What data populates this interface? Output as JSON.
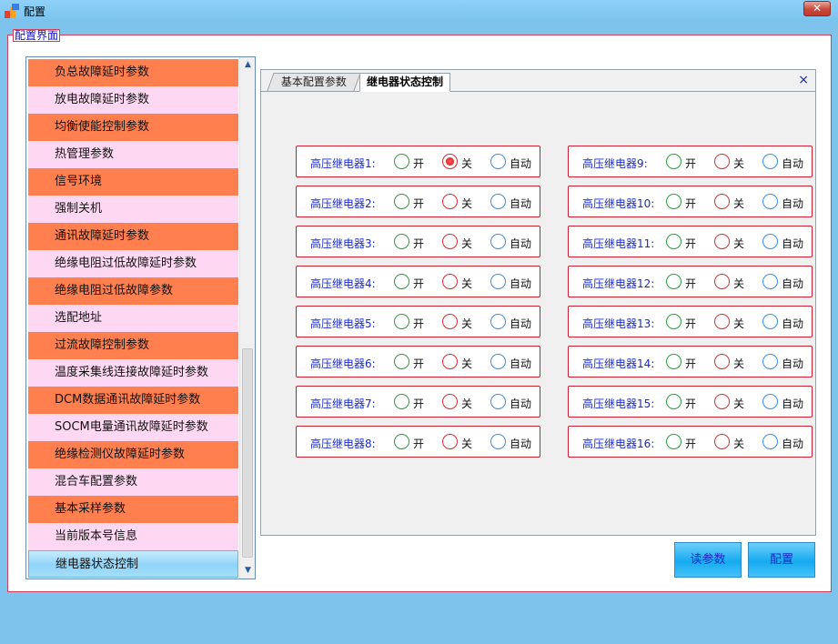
{
  "window": {
    "title": "配置",
    "close_glyph": "✕"
  },
  "group": {
    "label": "配置界面"
  },
  "sidebar": {
    "items": [
      {
        "label": "负总故障延时参数",
        "color": "orange"
      },
      {
        "label": "放电故障延时参数",
        "color": "pink"
      },
      {
        "label": "均衡使能控制参数",
        "color": "orange"
      },
      {
        "label": "热管理参数",
        "color": "pink"
      },
      {
        "label": "信号环境",
        "color": "orange"
      },
      {
        "label": "强制关机",
        "color": "pink"
      },
      {
        "label": "通讯故障延时参数",
        "color": "orange"
      },
      {
        "label": "绝缘电阻过低故障延时参数",
        "color": "pink"
      },
      {
        "label": "绝缘电阻过低故障参数",
        "color": "orange"
      },
      {
        "label": "选配地址",
        "color": "pink"
      },
      {
        "label": "过流故障控制参数",
        "color": "orange"
      },
      {
        "label": "温度采集线连接故障延时参数",
        "color": "pink"
      },
      {
        "label": "DCM数据通讯故障延时参数",
        "color": "orange"
      },
      {
        "label": "SOCM电量通讯故障延时参数",
        "color": "pink"
      },
      {
        "label": "绝缘检测仪故障延时参数",
        "color": "orange"
      },
      {
        "label": "混合车配置参数",
        "color": "pink"
      },
      {
        "label": "基本采样参数",
        "color": "orange"
      },
      {
        "label": "当前版本号信息",
        "color": "pink"
      },
      {
        "label": "继电器状态控制",
        "color": "selected"
      }
    ],
    "scroll_up_glyph": "▲",
    "scroll_down_glyph": "▼"
  },
  "tabs": {
    "items": [
      {
        "label": "基本配置参数",
        "active": false
      },
      {
        "label": "继电器状态控制",
        "active": true
      }
    ],
    "close_glyph": "×"
  },
  "relay_options": {
    "on": "开",
    "off": "关",
    "auto": "自动"
  },
  "relays": [
    {
      "label": "高压继电器1:",
      "selected": "off"
    },
    {
      "label": "高压继电器2:",
      "selected": "none"
    },
    {
      "label": "高压继电器3:",
      "selected": "none"
    },
    {
      "label": "高压继电器4:",
      "selected": "none"
    },
    {
      "label": "高压继电器5:",
      "selected": "none"
    },
    {
      "label": "高压继电器6:",
      "selected": "none"
    },
    {
      "label": "高压继电器7:",
      "selected": "none"
    },
    {
      "label": "高压继电器8:",
      "selected": "none"
    },
    {
      "label": "高压继电器9:",
      "selected": "none"
    },
    {
      "label": "高压继电器10:",
      "selected": "none"
    },
    {
      "label": "高压继电器11:",
      "selected": "none"
    },
    {
      "label": "高压继电器12:",
      "selected": "none"
    },
    {
      "label": "高压继电器13:",
      "selected": "none"
    },
    {
      "label": "高压继电器14:",
      "selected": "none"
    },
    {
      "label": "高压继电器15:",
      "selected": "none"
    },
    {
      "label": "高压继电器16:",
      "selected": "none"
    }
  ],
  "buttons": {
    "read_label": "读参数",
    "config_label": "配置"
  },
  "colors": {
    "background": "#7ec3ec",
    "item_orange": "#ff7f4f",
    "item_pink": "#fed8f2",
    "relay_border": "#cc2030",
    "relay_label": "#1a2ac8",
    "radio_on": "#2e9a3a",
    "radio_off": "#d03030",
    "radio_auto": "#3b8ee0",
    "button": "#15aaf0"
  }
}
